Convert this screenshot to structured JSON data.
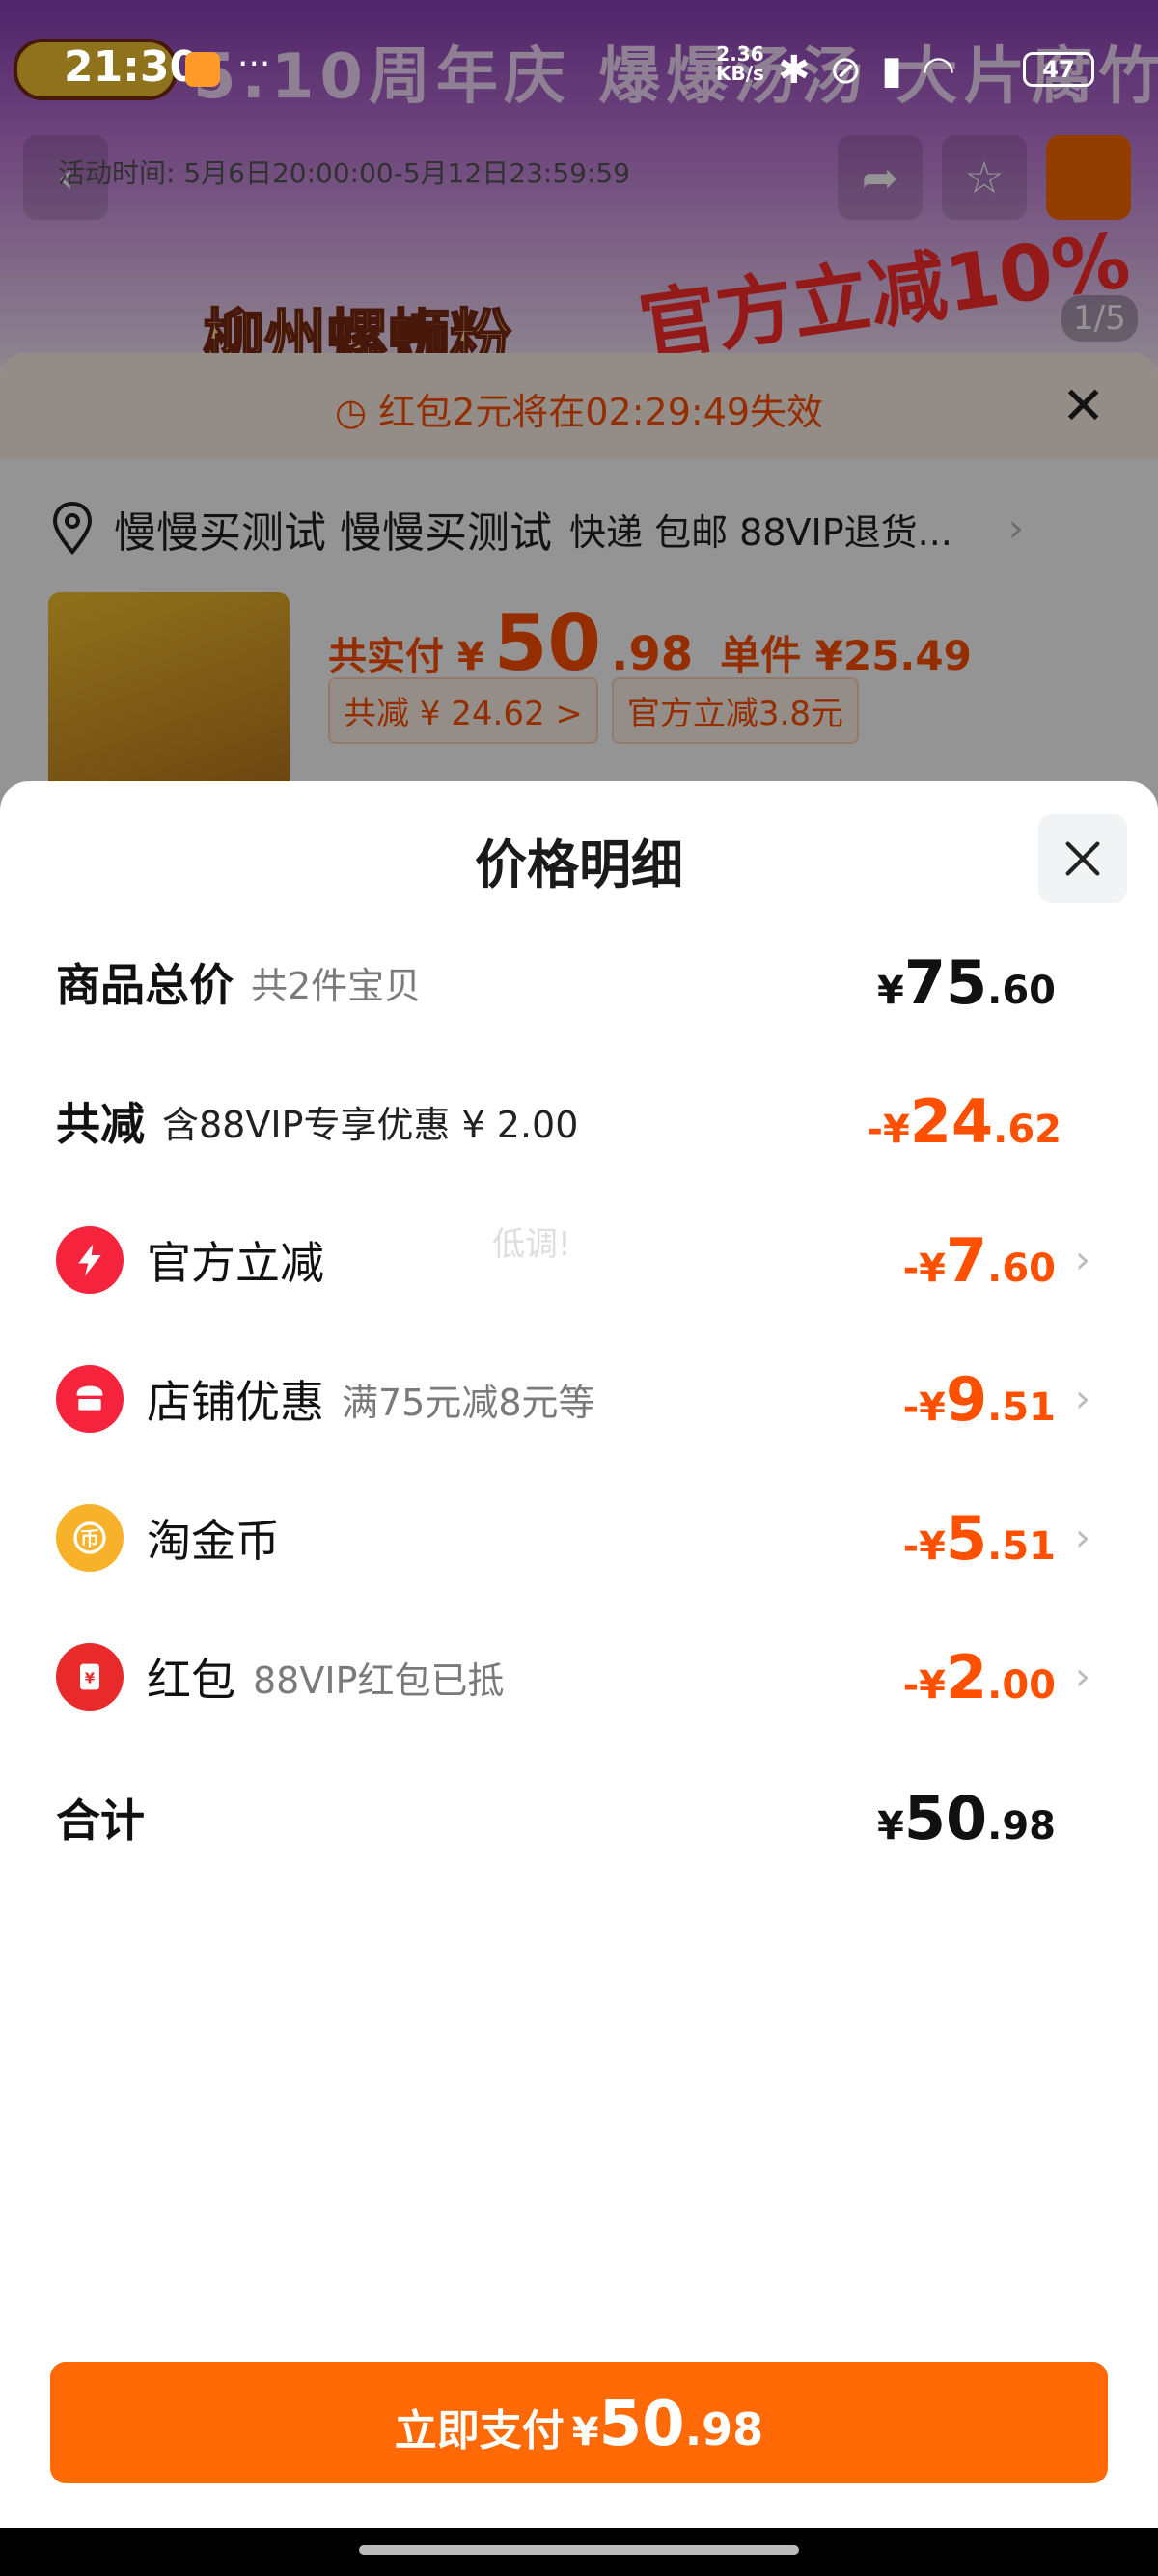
{
  "status_bar": {
    "time": "21:30",
    "more": "···",
    "net_speed_value": "2.36",
    "net_speed_unit": "KB/s",
    "battery": "47",
    "icons": [
      "bluetooth-icon",
      "mute-icon",
      "signal-icon",
      "wifi-icon"
    ]
  },
  "background": {
    "banner_title": "5.10周年庆  爆爆汤汤 大片腐竹",
    "activity_time": "活动时间: 5月6日20:00:00-5月12日23:59:59",
    "product_name": "柳州螺蛳粉",
    "promo": "官方立减10%",
    "page_indicator": "1/5",
    "red_packet_notice": "红包2元将在02:29:49失效",
    "address_name": "慢慢买测试 慢慢买测试",
    "address_extra": "快递 包邮 88VIP退货...",
    "total_label": "共实付 ¥",
    "total_int": "50",
    "total_dec": ".98",
    "unit_price": "单件 ¥25.49",
    "tag_reduction": "共减 ¥ 24.62 >",
    "tag_official": "官方立减3.8元"
  },
  "modal": {
    "title": "价格明细",
    "watermark": "低调!",
    "rows": {
      "goods_total": {
        "label": "商品总价",
        "sub": "共2件宝贝",
        "currency": "¥",
        "int": "75",
        "dec": ".60"
      },
      "total_reduction": {
        "label": "共减",
        "sub": "含88VIP专享优惠 ¥ 2.00",
        "currency": "-¥",
        "int": "24",
        "dec": ".62"
      },
      "official_reduction": {
        "label": "官方立减",
        "sub": "",
        "currency": "-¥",
        "int": "7",
        "dec": ".60",
        "icon": "lightning-icon",
        "icon_color": "#f5243c"
      },
      "store_discount": {
        "label": "店铺优惠",
        "sub": "满75元减8元等",
        "currency": "-¥",
        "int": "9",
        "dec": ".51",
        "icon": "store-icon",
        "icon_color": "#f5243c"
      },
      "taobao_coin": {
        "label": "淘金币",
        "sub": "",
        "currency": "-¥",
        "int": "5",
        "dec": ".51",
        "icon": "coin-icon",
        "icon_color": "#f7b22a"
      },
      "red_packet": {
        "label": "红包",
        "sub": "88VIP红包已抵",
        "currency": "-¥",
        "int": "2",
        "dec": ".00",
        "icon": "red-packet-icon",
        "icon_color": "#e82a2a"
      },
      "sum": {
        "label": "合计",
        "currency": "¥",
        "int": "50",
        "dec": ".98"
      }
    },
    "pay_button": {
      "label": "立即支付",
      "currency": "¥",
      "int": "50",
      "dec": ".98"
    }
  },
  "colors": {
    "accent": "#ff6a06",
    "discount_text": "#ff5000"
  }
}
